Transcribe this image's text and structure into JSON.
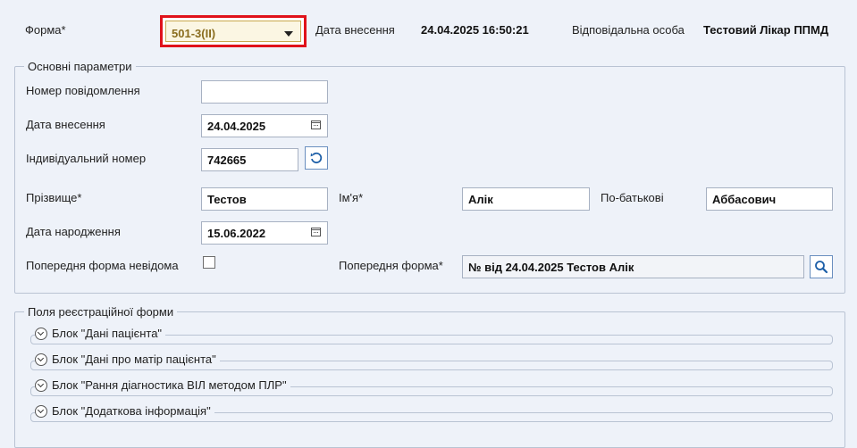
{
  "header": {
    "form_label": "Форма*",
    "form_value": "501-3(II)",
    "entry_date_label": "Дата внесення",
    "entry_datetime": "24.04.2025 16:50:21",
    "responsible_label": "Відповідальна особа",
    "responsible_value": "Тестовий Лікар ППМД"
  },
  "main_params": {
    "legend": "Основні параметри",
    "message_number_label": "Номер повідомлення",
    "message_number_value": "",
    "entry_date_label": "Дата внесення",
    "entry_date_value": "24.04.2025",
    "individual_number_label": "Індивідуальний номер",
    "individual_number_value": "742665",
    "surname_label": "Прізвище*",
    "surname_value": "Тестов",
    "name_label": "Ім'я*",
    "name_value": "Алік",
    "patronymic_label": "По-батькові",
    "patronymic_value": "Аббасович",
    "birth_date_label": "Дата народження",
    "birth_date_value": "15.06.2022",
    "prev_unknown_label": "Попередня форма невідома",
    "prev_form_label": "Попередня форма*",
    "prev_form_value": "№  від 24.04.2025 Тестов Алік"
  },
  "registration_fields": {
    "legend": "Поля реєстраційної форми",
    "blocks": [
      {
        "label": "Блок \"Дані пацієнта\""
      },
      {
        "label": "Блок \"Дані про матір пацієнта\""
      },
      {
        "label": "Блок \"Рання діагностика ВІЛ методом ПЛР\""
      },
      {
        "label": "Блок \"Додаткова інформація\""
      }
    ]
  },
  "colors": {
    "highlight_border": "#e0121b",
    "background": "#eef2f9",
    "icon_blue": "#1d5fa8"
  }
}
